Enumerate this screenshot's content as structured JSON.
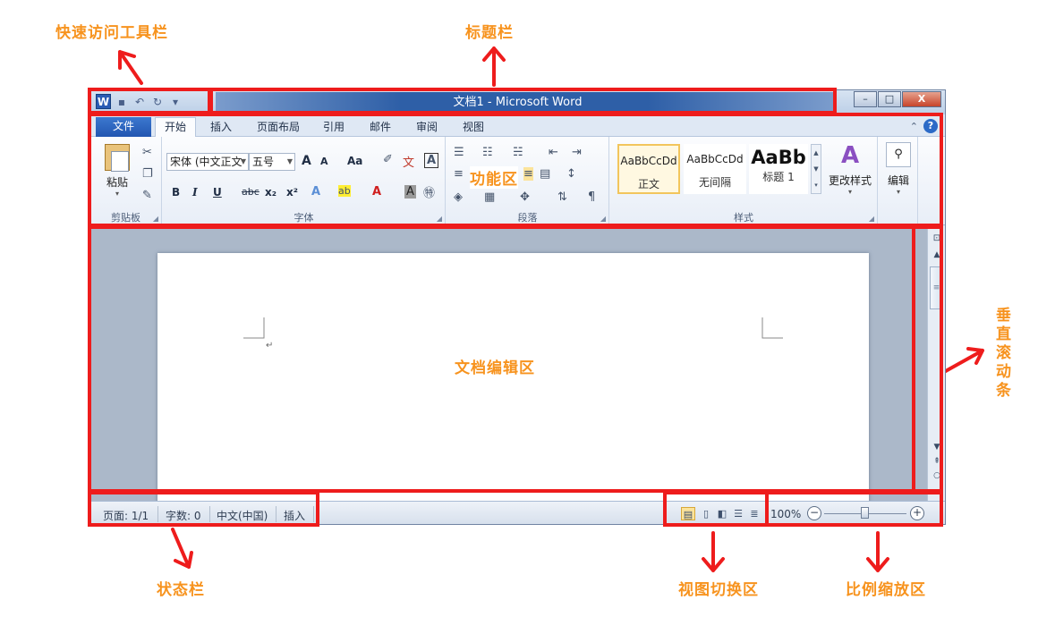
{
  "annotations": {
    "qat": "快速访问工具栏",
    "titlebar": "标题栏",
    "ribbon": "功能区",
    "doc": "文档编辑区",
    "vscroll": "垂直滚动条",
    "status": "状态栏",
    "views": "视图切换区",
    "zoom": "比例缩放区"
  },
  "colors": {
    "annotation": "#f7931e",
    "highlight_box": "#ee1c1c",
    "file_tab": "#2256b1"
  },
  "window": {
    "title": "文档1 - Microsoft Word",
    "logo_letter": "W",
    "controls": {
      "minimize": "–",
      "maximize": "□",
      "close": "X"
    }
  },
  "tabs": {
    "file": "文件",
    "home": "开始",
    "insert": "插入",
    "layout": "页面布局",
    "references": "引用",
    "mailings": "邮件",
    "review": "审阅",
    "view": "视图"
  },
  "help": {
    "collapse": "⌃",
    "question": "?"
  },
  "ribbon": {
    "clipboard": {
      "paste": "粘贴",
      "group": "剪贴板"
    },
    "font": {
      "font_name": "宋体 (中文正文",
      "font_size": "五号",
      "bold": "B",
      "italic": "I",
      "underline": "U",
      "strike": "abc",
      "subscript": "x₂",
      "superscript": "x²",
      "change_case": "Aa",
      "grow": "A",
      "shrink": "A",
      "group": "字体"
    },
    "paragraph": {
      "group": "段落"
    },
    "styles": {
      "normal_preview": "AaBbCcDd",
      "normal": "正文",
      "nospacing_preview": "AaBbCcDd",
      "nospacing": "无间隔",
      "h1_preview": "AaBb",
      "h1": "标题 1",
      "change_styles": "更改样式",
      "group": "样式"
    },
    "editing": {
      "label": "编辑"
    }
  },
  "statusbar": {
    "page": "页面: 1/1",
    "words": "字数: 0",
    "language": "中文(中国)",
    "mode": "插入",
    "zoom": "100%",
    "zoom_level_percent": 100
  }
}
